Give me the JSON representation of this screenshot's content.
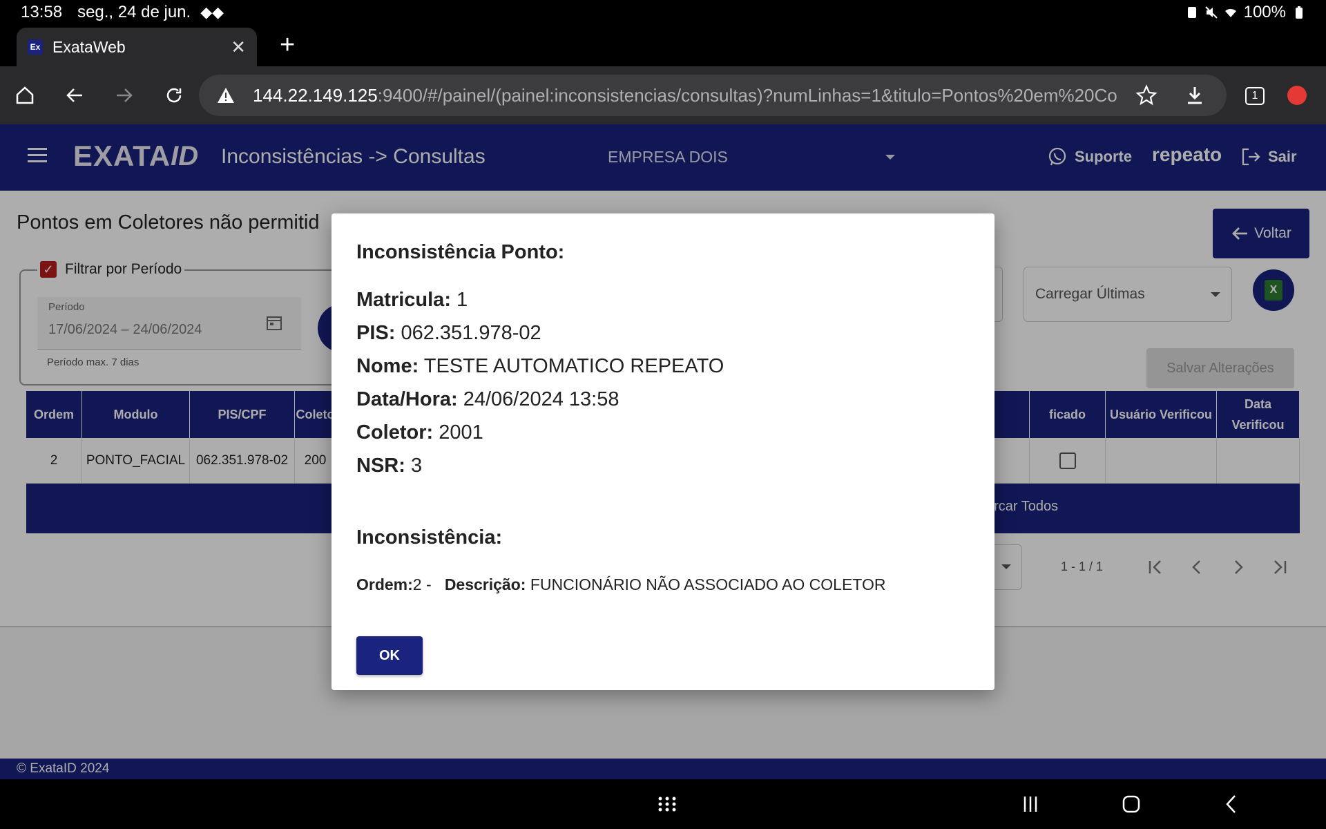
{
  "status_bar": {
    "time": "13:58",
    "date": "seg., 24 de jun.",
    "battery": "100%"
  },
  "browser": {
    "tab_title": "ExataWeb",
    "favicon_text": "Ex",
    "url_host": "144.22.149.125",
    "url_rest": ":9400/#/painel/(painel:inconsistencias/consultas)?numLinhas=1&titulo=Pontos%20em%20Co",
    "tab_count": "1"
  },
  "app": {
    "logo_text": "EXATA",
    "logo_id": "ID",
    "heading": "Inconsistências -> Consultas",
    "company": "EMPRESA DOIS",
    "support_label": "Suporte",
    "username": "repeato",
    "logout_label": "Sair"
  },
  "page": {
    "title": "Pontos em Coletores não permitid",
    "back_label": "Voltar",
    "filter_label": "Filtrar por Período",
    "period_label": "Período",
    "period_value": "17/06/2024 – 24/06/2024",
    "period_hint": "Período max. 7 dias",
    "load_label": "Carregar Últimas",
    "save_label": "Salvar Alterações",
    "excel_label": "xls"
  },
  "table": {
    "headers": [
      "Ordem",
      "Modulo",
      "PIS/CPF",
      "Coleto",
      "ficado",
      "Usuário Verificou",
      "Data Verificou"
    ],
    "row": [
      "2",
      "PONTO_FACIAL",
      "062.351.978-02",
      "200"
    ],
    "footer_label": "arcar Todos"
  },
  "pager": {
    "range": "1 - 1 / 1"
  },
  "footer": {
    "copyright": "© ExataID 2024"
  },
  "dialog": {
    "title": "Inconsistência Ponto:",
    "matricula_label": "Matricula:",
    "matricula_value": "1",
    "pis_label": "PIS:",
    "pis_value": "062.351.978-02",
    "nome_label": "Nome:",
    "nome_value": "TESTE AUTOMATICO REPEATO",
    "datahora_label": "Data/Hora:",
    "datahora_value": "24/06/2024 13:58",
    "coletor_label": "Coletor:",
    "coletor_value": "2001",
    "nsr_label": "NSR:",
    "nsr_value": "3",
    "section_title": "Inconsistência:",
    "ordem_label": "Ordem:",
    "ordem_value": "2 -",
    "descricao_label": "Descrição:",
    "descricao_value": "FUNCIONÁRIO NÃO ASSOCIADO AO COLETOR",
    "ok_label": "OK"
  }
}
